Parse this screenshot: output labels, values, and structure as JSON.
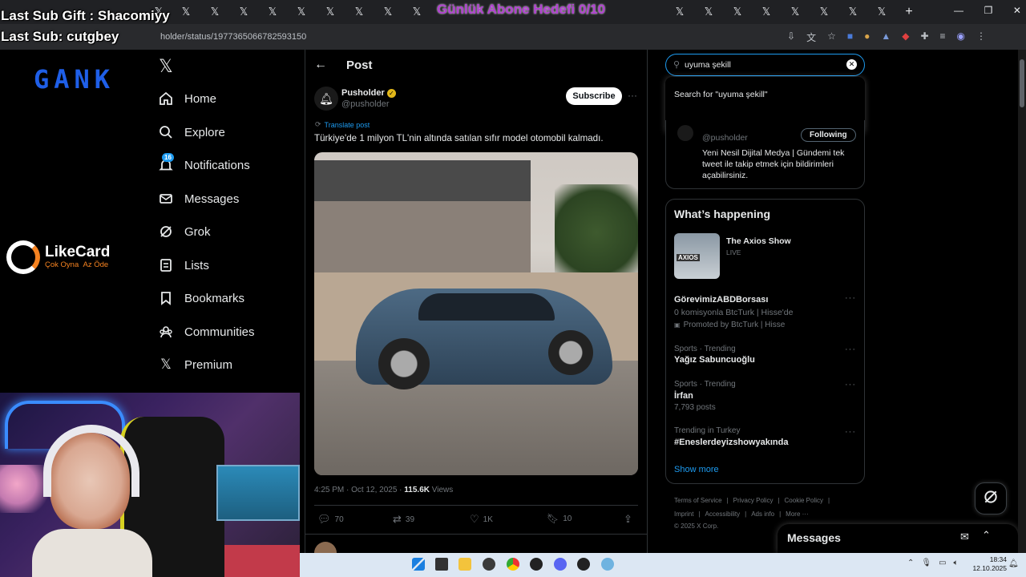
{
  "overlay": {
    "gift": "Last Sub Gift : Shacomiyy",
    "sub": "Last Sub: cutgbey",
    "goal": "Günlük Abone Hedefi 0/10",
    "sponsor_name": "LikeCard",
    "sponsor_tag1": "Çok Oyna",
    "sponsor_tag2": "Az Öde",
    "logo_text": "GANK"
  },
  "browser": {
    "url": "holder/status/1977365066782593150"
  },
  "nav": {
    "home": "Home",
    "explore": "Explore",
    "notifications": "Notifications",
    "notif_badge": "16",
    "messages": "Messages",
    "grok": "Grok",
    "lists": "Lists",
    "bookmarks": "Bookmarks",
    "communities": "Communities",
    "premium": "Premium"
  },
  "post": {
    "header": "Post",
    "author": "Pusholder",
    "handle": "@pusholder",
    "subscribe": "Subscribe",
    "translate": "Translate post",
    "text": "Türkiye'de 1 milyon TL'nin altında satılan sıfır model otomobil kalmadı.",
    "time": "4:25 PM · Oct 12, 2025 · ",
    "views_num": "115.6K",
    "views_label": " Views",
    "replies": "70",
    "reposts": "39",
    "likes": "1K",
    "bookmarks": "10"
  },
  "search": {
    "value": "uyuma şekill",
    "suggestion": "Search for \"uyuma şekill\""
  },
  "profile_card": {
    "handle": "@pusholder",
    "follow": "Following",
    "bio": "Yeni Nesil Dijital Medya | Gündemi tek tweet ile takip etmek için bildirimleri açabilirsiniz."
  },
  "happening": {
    "title": "What’s happening",
    "live_title": "The Axios Show",
    "live_label": "LIVE",
    "promo_title": "GörevimizABDBorsası",
    "promo_sub": "0 komisyonla BtcTurk | Hisse'de",
    "promo_by": "Promoted by BtcTurk | Hisse",
    "trends": [
      {
        "meta": "Sports · Trending",
        "title": "Yağız Sabuncuoğlu",
        "count": ""
      },
      {
        "meta": "Sports · Trending",
        "title": "İrfan",
        "count": "7,793 posts"
      },
      {
        "meta": "Trending in Turkey",
        "title": "#Eneslerdeyizshowyakında",
        "count": ""
      }
    ],
    "show_more": "Show more"
  },
  "footer": {
    "l1": [
      "Terms of Service",
      "Privacy Policy",
      "Cookie Policy"
    ],
    "l2": [
      "Imprint",
      "Accessibility",
      "Ads info",
      "More ···"
    ],
    "copy": "© 2025 X Corp."
  },
  "messages_dock": {
    "label": "Messages"
  },
  "taskbar": {
    "time": "18:34",
    "date": "12.10.2025"
  },
  "colors": {
    "accent": "#1d9bf0",
    "bg": "#000000",
    "border": "#2f3336",
    "muted": "#71767b"
  }
}
